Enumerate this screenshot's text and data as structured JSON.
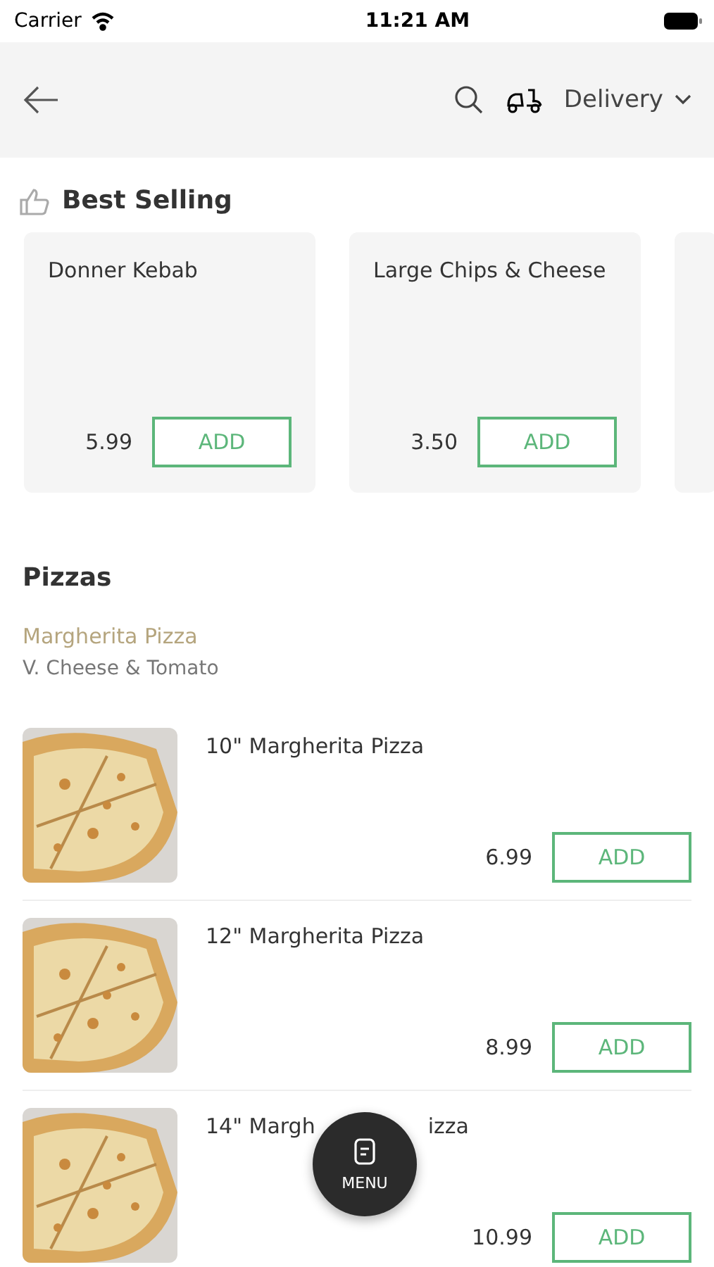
{
  "status_bar": {
    "carrier": "Carrier",
    "time": "11:21 AM"
  },
  "header": {
    "order_type": "Delivery"
  },
  "best_selling": {
    "title": "Best Selling",
    "items": [
      {
        "name": "Donner Kebab",
        "price": "5.99",
        "button": "ADD"
      },
      {
        "name": "Large Chips & Cheese",
        "price": "3.50",
        "button": "ADD"
      }
    ]
  },
  "section": {
    "title": "Pizzas",
    "category": "Margherita Pizza",
    "description": "V. Cheese & Tomato",
    "items": [
      {
        "name": "10\" Margherita Pizza",
        "price": "6.99",
        "button": "ADD",
        "kind": "picture"
      },
      {
        "name": "12\" Margherita Pizza",
        "price": "8.99",
        "button": "ADD",
        "kind": "picture"
      },
      {
        "name_parts": [
          "14\" Margh",
          "izza"
        ],
        "price": "10.99",
        "button": "ADD",
        "kind": "picture"
      }
    ]
  },
  "menu_button": {
    "label": "MENU"
  }
}
